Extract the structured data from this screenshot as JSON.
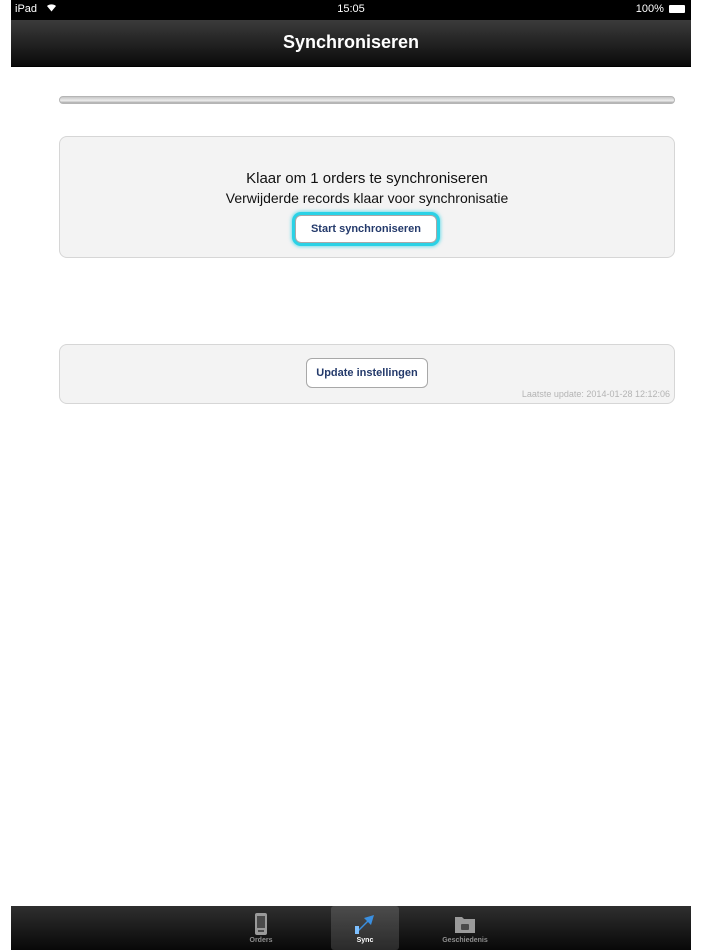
{
  "status_bar": {
    "device": "iPad",
    "time": "15:05",
    "battery": "100%"
  },
  "nav": {
    "title": "Synchroniseren"
  },
  "sync_panel": {
    "message": "Klaar om 1 orders te synchroniseren",
    "submessage": "Verwijderde records klaar voor synchronisatie",
    "start_button": "Start synchroniseren"
  },
  "update_panel": {
    "update_button": "Update instellingen",
    "last_update": "Laatste update: 2014-01-28 12:12:06"
  },
  "tabs": [
    {
      "label": "Orders",
      "icon": "orders-icon"
    },
    {
      "label": "Sync",
      "icon": "sync-icon",
      "active": true
    },
    {
      "label": "Geschiedenis",
      "icon": "folder-icon"
    }
  ],
  "colors": {
    "highlight": "#2ad2e6",
    "button_text": "#243a6b"
  }
}
